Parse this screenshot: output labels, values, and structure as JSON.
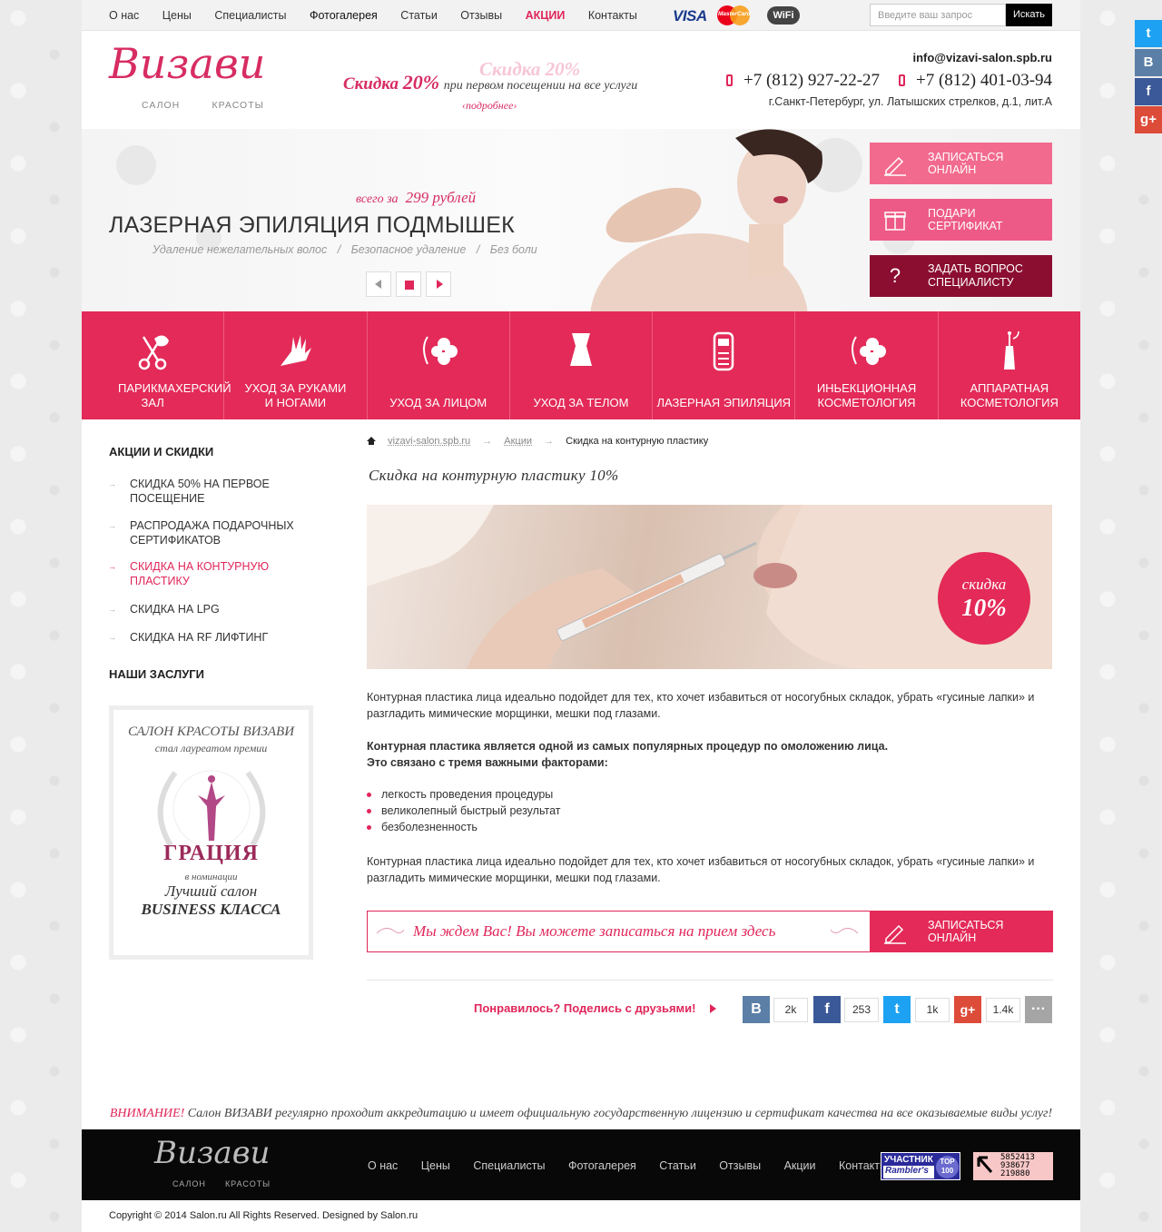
{
  "topnav": {
    "items": [
      "О нас",
      "Цены",
      "Специалисты",
      "Фотогалерея",
      "Статьи",
      "Отзывы",
      "АКЦИИ",
      "Контакты"
    ],
    "payments": {
      "visa": "VISA",
      "mastercard": "MasterCard",
      "wifi": "WiFi"
    },
    "search_placeholder": "Введите ваш запрос",
    "search_button": "Искать"
  },
  "header": {
    "logo_script": "Визави",
    "logo_sub_left": "салон",
    "logo_sub_right": "красоты",
    "promo_prefix": "Скидка",
    "promo_value": "20%",
    "promo_text": "при первом посещении на все услуги",
    "promo_more": "подробнее",
    "promo_ghost": "Скидка 20%",
    "email": "info@vizavi-salon.spb.ru",
    "phone1": "+7 (812) 927-22-27",
    "phone2": "+7 (812) 401-03-94",
    "address": "г.Санкт-Петербург, ул. Латышских стрелков,  д.1, лит.А"
  },
  "slider": {
    "price_prefix": "всего за",
    "price": "299 рублей",
    "title": "ЛАЗЕРНАЯ ЭПИЛЯЦИЯ ПОДМЫШЕК",
    "subs": [
      "Удаление нежелательных волос",
      "/",
      "Безопасное удаление",
      "/",
      "Без боли"
    ],
    "buttons": [
      {
        "label": "ЗАПИСАТЬСЯ ОНЛАЙН",
        "color": "#f26a8d"
      },
      {
        "label": "ПОДАРИ СЕРТИФИКАТ",
        "color": "#ee5a87"
      },
      {
        "label": "ЗАДАТЬ ВОПРОС СПЕЦИАЛИСТУ",
        "color": "#8b0d30"
      }
    ]
  },
  "categories": [
    {
      "label": "ПАРИКМАХЕРСКИЙ ЗАЛ",
      "icon": "scissors-icon"
    },
    {
      "label": "УХОД ЗА РУКАМИ И НОГАМИ",
      "icon": "hands-icon"
    },
    {
      "label": "УХОД ЗА ЛИЦОМ",
      "icon": "face-flower-icon"
    },
    {
      "label": "УХОД ЗА ТЕЛОМ",
      "icon": "corset-icon"
    },
    {
      "label": "ЛАЗЕРНАЯ ЭПИЛЯЦИЯ",
      "icon": "laser-device-icon"
    },
    {
      "label": "ИНЬЕКЦИОННАЯ КОСМЕТОЛОГИЯ",
      "icon": "face-flower-icon"
    },
    {
      "label": "АППАРАТНАЯ КОСМЕТОЛОГИЯ",
      "icon": "apparatus-icon"
    }
  ],
  "sidebar": {
    "heading": "АКЦИИ И СКИДКИ",
    "items": [
      {
        "label": "Скидка 50% на первое посещение"
      },
      {
        "label": "Распродажа подарочных сертификатов"
      },
      {
        "label": "Скидка на контурную пластику"
      },
      {
        "label": "Скидка на LPG"
      },
      {
        "label": "Скидка на RF лифтинг"
      }
    ],
    "awards_heading": "НАШИ ЗАСЛУГИ",
    "award": {
      "line1": "САЛОН КРАСОТЫ ВИЗАВИ",
      "line2": "стал лауреатом премии",
      "name": "ГРАЦИЯ",
      "line3": "в номинации",
      "line4": "Лучший салон",
      "line5": "BUSINESS КЛАССА"
    }
  },
  "breadcrumb": {
    "home": "vizavi-salon.spb.ru",
    "section": "Акции",
    "current": "Скидка на контурную пластику"
  },
  "article": {
    "title": "Скидка на контурную пластику 10%",
    "badge_label": "скидка",
    "badge_value": "10%",
    "p1": "Контурная пластика лица идеально подойдет для тех, кто хочет избавиться от носогубных складок, убрать «гусиные лапки» и разгладить мимические морщинки, мешки под глазами.",
    "p2a": "Контурная пластика является одной из самых популярных процедур по омоложению лица.",
    "p2b": "Это связано с тремя важными факторами:",
    "bullets": [
      "легкость проведения процедуры",
      "великолепный быстрый результат",
      "безболезненность"
    ],
    "p3": "Контурная пластика лица идеально подойдет для тех, кто хочет избавиться от носогубных складок, убрать «гусиные лапки» и разгладить мимические морщинки, мешки под глазами.",
    "cta_text": "Мы ждем Вас! Вы можете записаться на прием здесь",
    "cta_button": "ЗАПИСАТЬСЯ ОНЛАЙН"
  },
  "share": {
    "text": "Понравилось? Поделись с друзьями!",
    "networks": [
      {
        "icon": "vk-icon",
        "glyph": "В",
        "count": "2k",
        "color": "#5b7fa6"
      },
      {
        "icon": "facebook-icon",
        "glyph": "f",
        "count": "253",
        "color": "#3b5998"
      },
      {
        "icon": "twitter-icon",
        "glyph": "t",
        "count": "1k",
        "color": "#1da1f2"
      },
      {
        "icon": "googleplus-icon",
        "glyph": "g+",
        "count": "1.4k",
        "color": "#dd4b39"
      }
    ],
    "more": "···"
  },
  "notice": {
    "label": "ВНИМАНИЕ!",
    "text": "Салон ВИЗАВИ регулярно проходит аккредитацию и имеет официальную государственную лицензию и сертификат качества на все оказываемые виды услуг!"
  },
  "footer": {
    "logo_script": "Визави",
    "logo_sub_left": "салон",
    "logo_sub_right": "красоты",
    "nav": [
      "О нас",
      "Цены",
      "Специалисты",
      "Фотогалерея",
      "Статьи",
      "Отзывы",
      "Акции",
      "Контакты"
    ],
    "rambler_top": "УЧАСТНИК",
    "rambler_bottom": "Rambler's",
    "rambler_badge": "TOP 100",
    "counter_lines": [
      "5852413",
      "938677",
      "219880"
    ],
    "copyright": "Copyright © 2014 Salon.ru All Rights Reserved. Designed by Salon.ru"
  },
  "social_side": [
    {
      "icon": "twitter-icon",
      "glyph": "t",
      "color": "#1da1f2"
    },
    {
      "icon": "vk-icon",
      "glyph": "В",
      "color": "#5b7fa6"
    },
    {
      "icon": "facebook-icon",
      "glyph": "f",
      "color": "#3b5998"
    },
    {
      "icon": "googleplus-icon",
      "glyph": "g+",
      "color": "#dd4b39"
    }
  ]
}
